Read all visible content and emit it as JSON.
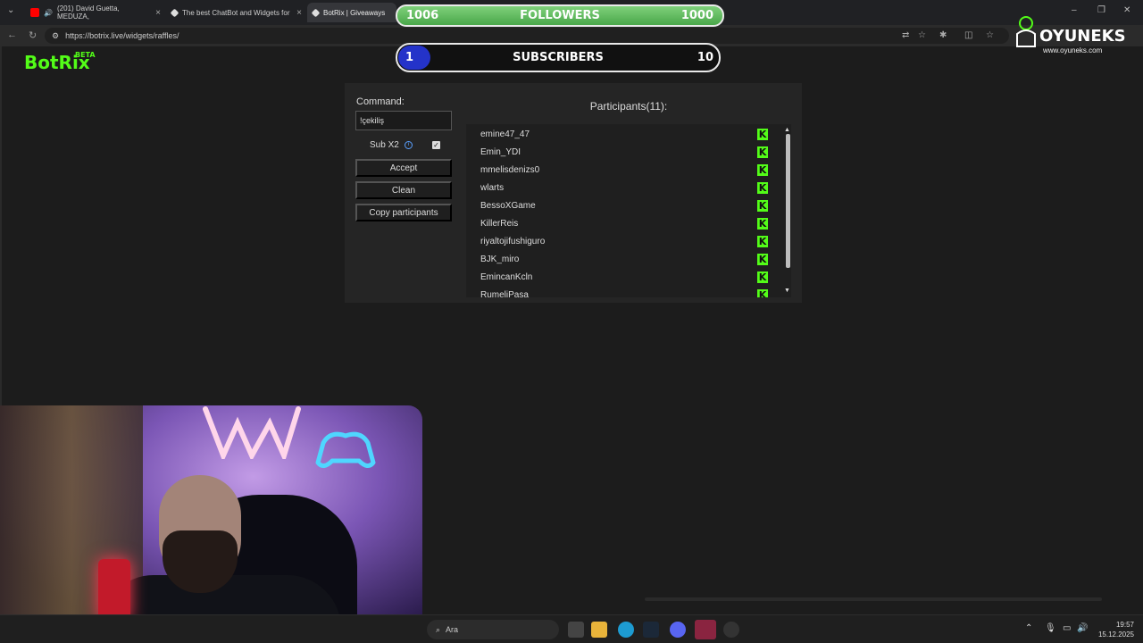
{
  "browser": {
    "tabs": [
      {
        "title": "(201) David Guetta, MEDUZA,"
      },
      {
        "title": "The best ChatBot and Widgets for"
      },
      {
        "title": "BotRix | Giveaways"
      }
    ],
    "url": "https://botrix.live/widgets/raffles/"
  },
  "app": {
    "logo": "BotRix",
    "badge": "BETA"
  },
  "raffle": {
    "command_label": "Command:",
    "command_value": "!çekiliş",
    "sub_label": "Sub X2",
    "sub_checked": true,
    "accept_label": "Accept",
    "clean_label": "Clean",
    "copy_label": "Copy participants",
    "participants_title": "Participants(11):",
    "participants": [
      "emine47_47",
      "Emin_YDI",
      "mmelisdenizs0",
      "wlarts",
      "BessoXGame",
      "KillerReis",
      "riyaltojifushiguro",
      "BJK_miro",
      "EmincanKcln",
      "RumeliPasa"
    ]
  },
  "overlay": {
    "followers_current": "1006",
    "followers_label": "FOLLOWERS",
    "followers_goal": "1000",
    "subs_current": "1",
    "subs_label": "SUBSCRIBERS",
    "subs_goal": "10",
    "subs_progress": 0.1,
    "brand_name": "OYUNEKS",
    "brand_site": "www.oyuneks.com"
  },
  "taskbar": {
    "search_placeholder": "Ara",
    "time": "19:57",
    "date": "15.12.2025"
  },
  "colors": {
    "kick_green": "#53fc18",
    "panel_bg": "#252525",
    "sub_fill": "#2433c9"
  }
}
